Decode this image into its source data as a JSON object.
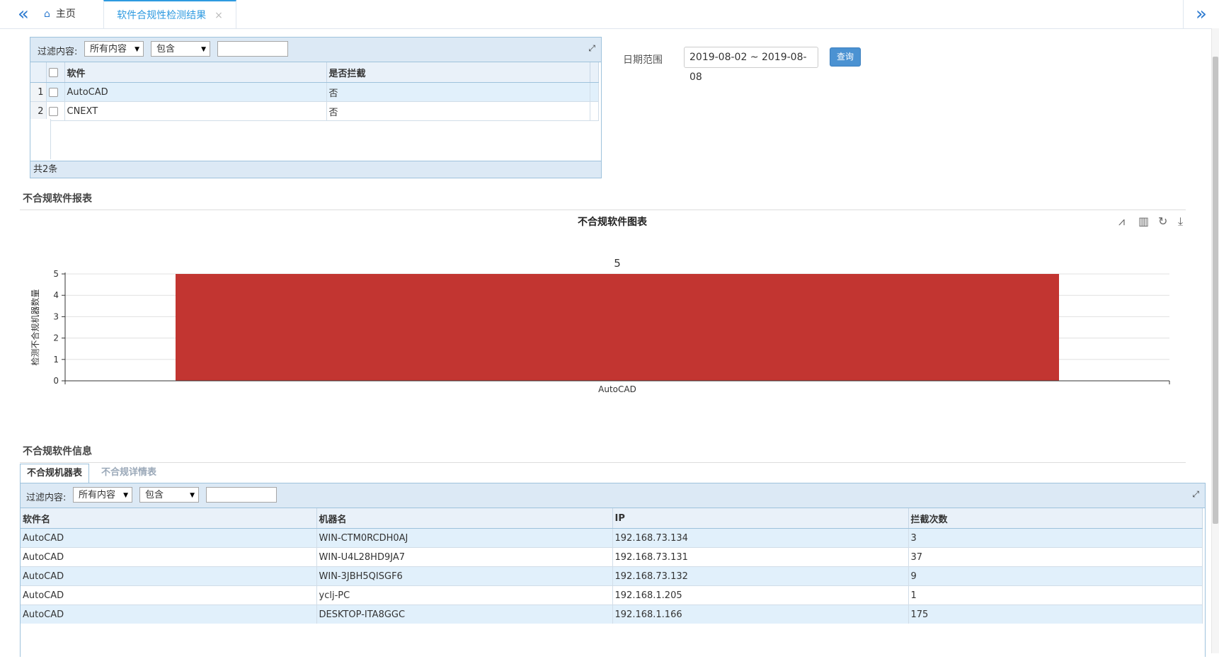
{
  "topbar": {
    "home_tab": "主页",
    "active_tab": "软件合规性检测结果",
    "close_glyph": "×"
  },
  "top_grid": {
    "filter_label": "过滤内容:",
    "filter_field": "所有内容",
    "filter_op": "包含",
    "filter_value": "",
    "columns": [
      "软件",
      "是否拦截"
    ],
    "rows": [
      {
        "num": "1",
        "software": "AutoCAD",
        "blocked": "否"
      },
      {
        "num": "2",
        "software": "CNEXT",
        "blocked": "否"
      }
    ],
    "footer": "共2条"
  },
  "date_filter": {
    "label": "日期范围",
    "value": "2019-08-02 ~ 2019-08-08",
    "button": "查询"
  },
  "report_section": {
    "title": "不合规软件报表"
  },
  "chart_data": {
    "type": "bar",
    "title": "不合规软件图表",
    "categories": [
      "AutoCAD"
    ],
    "values": [
      5
    ],
    "data_labels": [
      "5"
    ],
    "ylabel": "检测不合规机器数量",
    "xlabel": "",
    "ylim": [
      0,
      5
    ],
    "yticks": [
      0,
      1,
      2,
      3,
      4,
      5
    ],
    "grid": true,
    "bar_color": "#c23531",
    "toolbox": [
      "line-chart-icon",
      "bar-chart-icon",
      "restore-icon",
      "download-icon"
    ]
  },
  "info_section": {
    "title": "不合规软件信息",
    "tabs": [
      "不合规机器表",
      "不合规详情表"
    ]
  },
  "bottom_grid": {
    "filter_label": "过滤内容:",
    "filter_field": "所有内容",
    "filter_op": "包含",
    "filter_value": "",
    "columns": [
      "软件名",
      "机器名",
      "IP",
      "拦截次数"
    ],
    "rows": [
      {
        "software": "AutoCAD",
        "machine": "WIN-CTM0RCDH0AJ",
        "ip": "192.168.73.134",
        "count": "3"
      },
      {
        "software": "AutoCAD",
        "machine": "WIN-U4L28HD9JA7",
        "ip": "192.168.73.131",
        "count": "37"
      },
      {
        "software": "AutoCAD",
        "machine": "WIN-3JBH5QISGF6",
        "ip": "192.168.73.132",
        "count": "9"
      },
      {
        "software": "AutoCAD",
        "machine": "yclj-PC",
        "ip": "192.168.1.205",
        "count": "1"
      },
      {
        "software": "AutoCAD",
        "machine": "DESKTOP-ITA8GGC",
        "ip": "192.168.1.166",
        "count": "175"
      }
    ]
  }
}
